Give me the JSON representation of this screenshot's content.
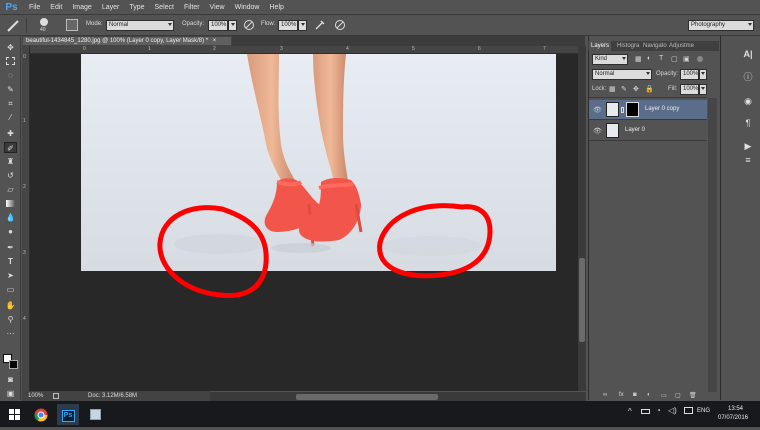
{
  "app": {
    "logo": "Ps"
  },
  "menu": [
    "File",
    "Edit",
    "Image",
    "Layer",
    "Type",
    "Select",
    "Filter",
    "View",
    "Window",
    "Help"
  ],
  "options": {
    "brush_size": "40",
    "mode_label": "Mode:",
    "mode_value": "Normal",
    "opacity_label": "Opacity:",
    "opacity_value": "100%",
    "flow_label": "Flow:",
    "flow_value": "100%",
    "workspace": "Photography"
  },
  "document": {
    "tab_title": "beautiful-1434845_1280.jpg @ 100% (Layer 0 copy, Layer Mask/8) *",
    "close": "×",
    "ruler_numbers": [
      "0",
      "1",
      "2",
      "3",
      "4",
      "5",
      "6",
      "7",
      "8"
    ],
    "zoom": "100%",
    "doc_size": "Doc: 3.12M/6.58M"
  },
  "panel": {
    "tabs": [
      "Layers",
      "Histogra",
      "Navigato",
      "Adjustme"
    ],
    "filter_kind": "Kind",
    "blend_mode": "Normal",
    "opacity_label": "Opacity:",
    "opacity_value": "100%",
    "lock_label": "Lock:",
    "fill_label": "Fill:",
    "fill_value": "100%",
    "layers": [
      {
        "name": "Layer 0 copy",
        "selected": true
      },
      {
        "name": "Layer 0",
        "selected": false
      }
    ]
  },
  "taskbar": {
    "language": "ENG",
    "time": "13:54",
    "date": "07/07/2016"
  },
  "colors": {
    "annotation_red": "#ff0000",
    "shoe_color": "#f2564a",
    "selected_layer": "#5a6e8c"
  },
  "icons": [
    "brush-icon",
    "search-icon",
    "gear-icon",
    "eye-icon",
    "windows-icon",
    "chrome-icon",
    "photoshop-icon"
  ]
}
